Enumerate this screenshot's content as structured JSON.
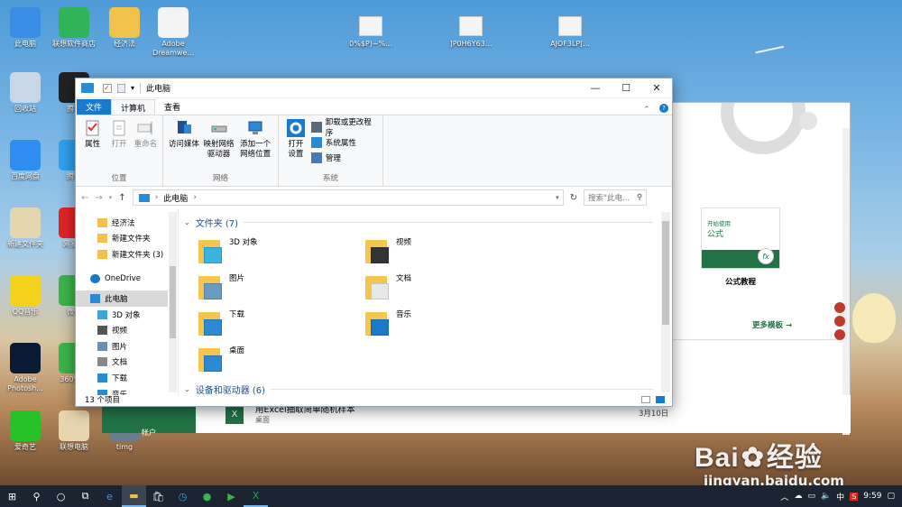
{
  "desktop": {
    "icons": [
      {
        "label": "此电脑",
        "icon": "computer-icon",
        "color": "#3a8ee6"
      },
      {
        "label": "联想软件商店",
        "icon": "store-icon",
        "color": "#2fb45a"
      },
      {
        "label": "经济法",
        "icon": "folder-icon",
        "color": "#f0c24b"
      },
      {
        "label": "Adobe Dreamwe...",
        "icon": "document-icon",
        "color": "#f4f4f4"
      },
      {
        "label": "回收站",
        "icon": "recycle-bin-icon",
        "color": "#c9d6e6"
      },
      {
        "label": "腾讯",
        "icon": "qq-icon",
        "color": "#222"
      },
      {
        "label": "百度网盘",
        "icon": "baidu-netdisk-icon",
        "color": "#2f8cf0"
      },
      {
        "label": "腾讯",
        "icon": "tencent-video-icon",
        "color": "#2fa0f0"
      },
      {
        "label": "新建文件夹",
        "icon": "folder-doc-icon",
        "color": "#e6d6b0"
      },
      {
        "label": "网易云",
        "icon": "netease-music-icon",
        "color": "#e02424"
      },
      {
        "label": "QQ音乐",
        "icon": "qq-music-icon",
        "color": "#f4d21c"
      },
      {
        "label": "微信",
        "icon": "wechat-icon",
        "color": "#3ab54a"
      },
      {
        "label": "Adobe Photosh...",
        "icon": "photoshop-icon",
        "color": "#0a1a33"
      },
      {
        "label": "360安全",
        "icon": "360-icon",
        "color": "#3ab54a"
      },
      {
        "label": "爱奇艺",
        "icon": "iqiyi-icon",
        "color": "#27c227"
      },
      {
        "label": "联想电脑",
        "icon": "lenovo-icon",
        "color": "#e6d6b0"
      },
      {
        "label": "timg",
        "icon": "image-icon",
        "color": "#6a7c8c"
      }
    ],
    "file_icons": [
      {
        "label": "0%$P)~%..."
      },
      {
        "label": "]P0H6Y63..."
      },
      {
        "label": "AJOF3LP[..."
      }
    ]
  },
  "explorer": {
    "title": "此电脑",
    "window_buttons": {
      "minimize": "—",
      "maximize": "☐",
      "close": "✕"
    },
    "tabs": [
      "文件",
      "计算机",
      "查看"
    ],
    "ribbon": {
      "groups": [
        {
          "name": "位置",
          "buttons": [
            "属性",
            "打开",
            "重命名"
          ]
        },
        {
          "name": "网络",
          "buttons": [
            "访问媒体",
            "映射网络\n驱动器",
            "添加一个\n网络位置"
          ]
        },
        {
          "name": "系统",
          "buttons": [
            "打开\n设置"
          ],
          "small": [
            "卸载或更改程序",
            "系统属性",
            "管理"
          ]
        }
      ]
    },
    "address": {
      "path": "此电脑",
      "search_placeholder": "搜索\"此电..."
    },
    "nav_items": [
      {
        "label": "经济法",
        "icon": "folder-icon",
        "indent": 1
      },
      {
        "label": "新建文件夹",
        "icon": "folder-icon",
        "indent": 1
      },
      {
        "label": "新建文件夹 (3)",
        "icon": "folder-icon",
        "indent": 1
      },
      {
        "label": "OneDrive",
        "icon": "onedrive-icon",
        "indent": 0
      },
      {
        "label": "此电脑",
        "icon": "computer-icon",
        "indent": 0,
        "selected": true
      },
      {
        "label": "3D 对象",
        "icon": "3d-objects-icon",
        "indent": 1
      },
      {
        "label": "视频",
        "icon": "video-icon",
        "indent": 1
      },
      {
        "label": "图片",
        "icon": "pictures-icon",
        "indent": 1
      },
      {
        "label": "文档",
        "icon": "documents-icon",
        "indent": 1
      },
      {
        "label": "下载",
        "icon": "downloads-icon",
        "indent": 1
      },
      {
        "label": "音乐",
        "icon": "music-icon",
        "indent": 1
      }
    ],
    "folders_header": "文件夹 (7)",
    "folders": [
      {
        "label": "3D 对象",
        "icon": "3d-objects-icon"
      },
      {
        "label": "视频",
        "icon": "video-icon"
      },
      {
        "label": "图片",
        "icon": "pictures-icon"
      },
      {
        "label": "文档",
        "icon": "documents-icon"
      },
      {
        "label": "下载",
        "icon": "downloads-icon"
      },
      {
        "label": "音乐",
        "icon": "music-icon"
      },
      {
        "label": "桌面",
        "icon": "desktop-icon"
      }
    ],
    "devices_header": "设备和驱动器 (6)",
    "status": "13 个项目"
  },
  "excel_bg": {
    "card_small": "开始使用",
    "card_title": "公式",
    "card_caption": "公式教程",
    "more_templates": "更多模板",
    "recent_file": "用Excel抽取简单随机样本",
    "recent_location": "桌面",
    "recent_date": "3月10日",
    "date_partial": "期",
    "account": "帐户"
  },
  "watermark": {
    "brand": "Bai",
    "brand2": "经验",
    "url": "jingyan.baidu.com"
  },
  "taskbar": {
    "tray_time": "9:59",
    "ime": "中"
  },
  "colors": {
    "accent": "#1979ca",
    "excel_green": "#217346"
  }
}
